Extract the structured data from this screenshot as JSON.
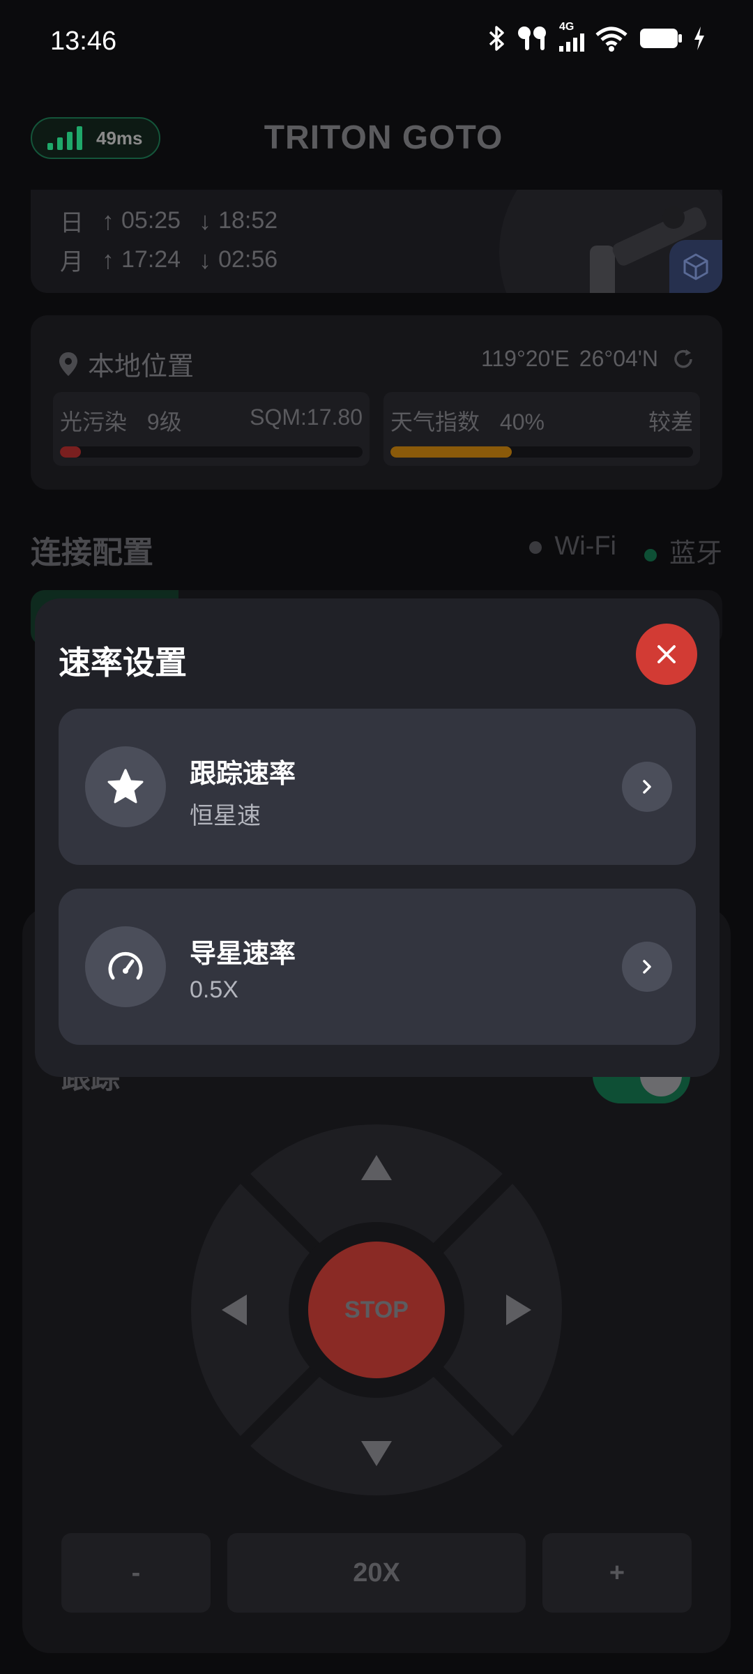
{
  "status_bar": {
    "time": "13:46",
    "icons": [
      "bluetooth-icon",
      "earbuds-icon",
      "cell-signal-icon",
      "wifi-icon",
      "battery-icon",
      "charging-icon"
    ],
    "network_label": "4G"
  },
  "header": {
    "latency": "49ms",
    "title": "TRITON GOTO"
  },
  "sun_moon": {
    "sun_label": "日",
    "sun_rise": "05:25",
    "sun_set": "18:52",
    "moon_label": "月",
    "moon_rise": "17:24",
    "moon_set": "02:56"
  },
  "location": {
    "label": "本地位置",
    "longitude": "119°20'E",
    "latitude": "26°04'N",
    "light_pollution_label": "光污染",
    "light_pollution_level": "9级",
    "sqm": "SQM:17.80",
    "light_pollution_fill": 0.07,
    "weather_label": "天气指数",
    "weather_percent": "40%",
    "weather_quality": "较差",
    "weather_fill": 0.4
  },
  "connection": {
    "title": "连接配置",
    "wifi": "Wi-Fi",
    "bluetooth": "蓝牙"
  },
  "controls": {
    "tracking_label": "跟踪",
    "stop": "STOP",
    "minus": "-",
    "speed": "20X",
    "plus": "+"
  },
  "modal": {
    "title": "速率设置",
    "options": [
      {
        "name": "跟踪速率",
        "value": "恒星速",
        "icon": "star-icon"
      },
      {
        "name": "导星速率",
        "value": "0.5X",
        "icon": "speedometer-icon"
      }
    ]
  },
  "colors": {
    "accent_green": "#1fa86a",
    "close_red": "#d23b34",
    "light_pollution_red": "#7a1f1f",
    "weather_orange": "#8a5a0a"
  }
}
